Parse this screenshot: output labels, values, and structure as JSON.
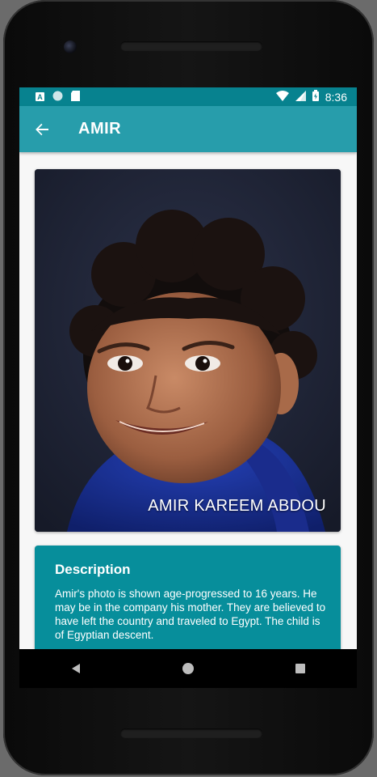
{
  "status_bar": {
    "time": "8:36",
    "left_icons": [
      "a-notification-icon",
      "circle-notification-icon",
      "sd-card-icon"
    ],
    "right_icons": [
      "wifi-icon",
      "signal-icon",
      "battery-charging-icon"
    ]
  },
  "app_bar": {
    "title": "AMIR",
    "back_icon": "arrow-back-icon"
  },
  "photo": {
    "caption": "AMIR KAREEM ABDOU"
  },
  "description": {
    "heading": "Description",
    "text": "Amir's photo is shown age-progressed to 16 years. He may be in the company his mother.  They are believed to have left the country and traveled to Egypt.  The child is of Egyptian descent."
  },
  "nav_bar": {
    "buttons": [
      "back-triangle",
      "home-circle",
      "recents-square"
    ]
  },
  "colors": {
    "status_bar": "#07828f",
    "app_bar": "#279dab",
    "card": "#078e9b"
  }
}
